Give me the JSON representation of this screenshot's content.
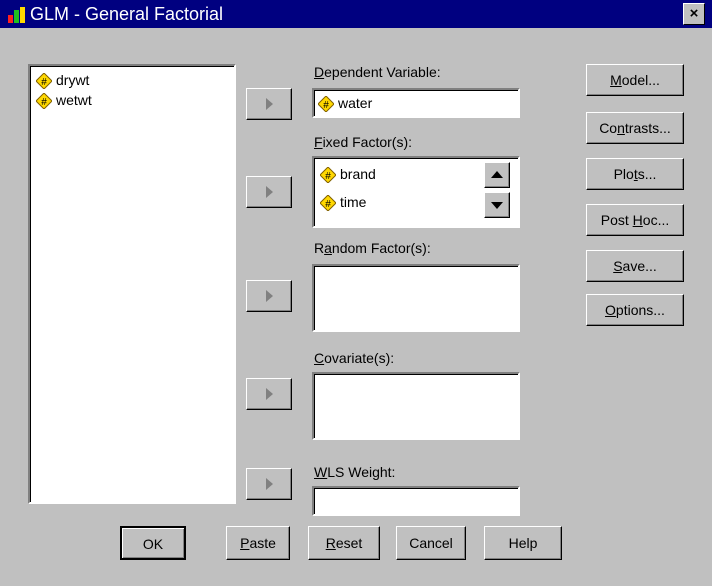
{
  "window": {
    "title": "GLM - General Factorial",
    "close_label": "×"
  },
  "source_list": {
    "items": [
      "drywt",
      "wetwt"
    ]
  },
  "dependent_variable": {
    "label_u": "D",
    "label_rest": "ependent Variable:",
    "value": "water"
  },
  "fixed_factors": {
    "label_u": "F",
    "label_rest": "ixed Factor(s):",
    "items": [
      "brand",
      "time"
    ]
  },
  "random_factors": {
    "label_pre": "R",
    "label_u": "a",
    "label_rest": "ndom Factor(s):"
  },
  "covariates": {
    "label_u": "C",
    "label_rest": "ovariate(s):"
  },
  "wls_weight": {
    "label_u": "W",
    "label_rest": "LS Weight:"
  },
  "side_buttons": {
    "model": {
      "u": "M",
      "rest": "odel..."
    },
    "contrasts": {
      "pre": "Co",
      "u": "n",
      "rest": "trasts..."
    },
    "plots": {
      "pre": "Plo",
      "u": "t",
      "rest": "s..."
    },
    "post_hoc": {
      "pre": "Post ",
      "u": "H",
      "rest": "oc..."
    },
    "save": {
      "u": "S",
      "rest": "ave..."
    },
    "options": {
      "u": "O",
      "rest": "ptions..."
    }
  },
  "bottom_buttons": {
    "ok": "OK",
    "paste": {
      "u": "P",
      "rest": "aste"
    },
    "reset": {
      "u": "R",
      "rest": "eset"
    },
    "cancel": "Cancel",
    "help": "Help"
  },
  "colors": {
    "titlebar": "#000080",
    "dialog": "#c0c0c0",
    "variable_icon": "#ffd800"
  }
}
